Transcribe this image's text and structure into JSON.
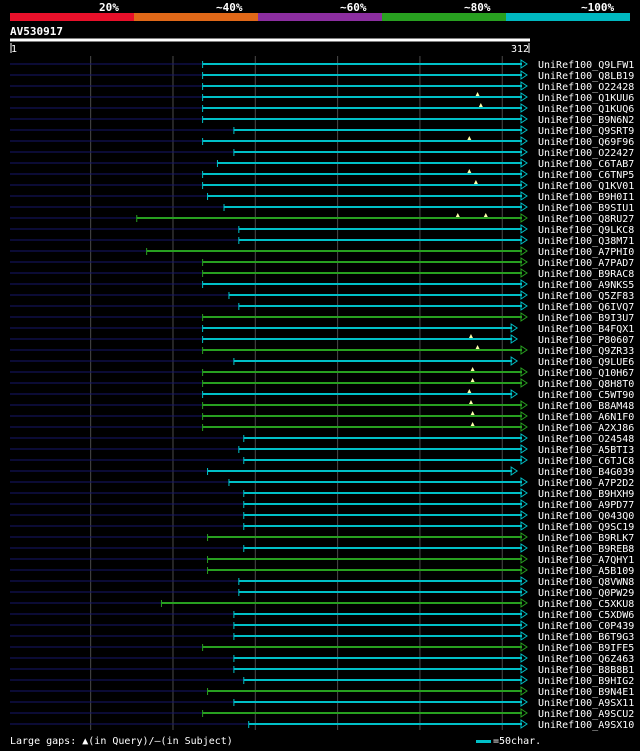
{
  "query": {
    "id": "AV530917",
    "start": "1",
    "end": "312"
  },
  "legend": {
    "bins": [
      {
        "label": "20%",
        "color": "#e8102a"
      },
      {
        "label": "~40%",
        "color": "#e06818"
      },
      {
        "label": "~60%",
        "color": "#8c2ea0"
      },
      {
        "label": "~80%",
        "color": "#28a020"
      },
      {
        "label": "~100%",
        "color": "#00b8c0"
      }
    ]
  },
  "footer": {
    "gaps_label": "Large gaps: ",
    "gap_query_icon": "triangle-up-icon",
    "gaps_query": "(in Query)/",
    "gap_subject_icon": "dash-icon",
    "gaps_subject": "(in Subject)",
    "scale_label": "=50char."
  },
  "chart_data": {
    "type": "alignment-overview",
    "query_length": 312,
    "x_range": [
      1,
      312
    ],
    "grid": true,
    "hits": [
      {
        "name": "UniRef100_Q9LFW1",
        "start": 118,
        "end": 312,
        "color": "cyan",
        "arrow": "open",
        "gaps": []
      },
      {
        "name": "UniRef100_Q8LB19",
        "start": 118,
        "end": 312,
        "color": "cyan",
        "arrow": "open",
        "gaps": []
      },
      {
        "name": "UniRef100_O22428",
        "start": 118,
        "end": 312,
        "color": "cyan",
        "arrow": "open",
        "gaps": []
      },
      {
        "name": "UniRef100_Q1KUU6",
        "start": 118,
        "end": 312,
        "color": "cyan",
        "arrow": "open",
        "gaps": [
          285
        ]
      },
      {
        "name": "UniRef100_Q1KUQ6",
        "start": 118,
        "end": 312,
        "color": "cyan",
        "arrow": "open",
        "gaps": [
          287
        ]
      },
      {
        "name": "UniRef100_B9N6N2",
        "start": 118,
        "end": 312,
        "color": "cyan",
        "arrow": "open",
        "gaps": []
      },
      {
        "name": "UniRef100_Q9SRT9",
        "start": 137,
        "end": 312,
        "color": "cyan",
        "arrow": "open",
        "gaps": []
      },
      {
        "name": "UniRef100_Q69F96",
        "start": 118,
        "end": 312,
        "color": "cyan",
        "arrow": "open",
        "gaps": [
          280
        ]
      },
      {
        "name": "UniRef100_O22427",
        "start": 137,
        "end": 312,
        "color": "cyan",
        "arrow": "open",
        "gaps": []
      },
      {
        "name": "UniRef100_C6TAB7",
        "start": 127,
        "end": 312,
        "color": "cyan",
        "arrow": "open",
        "gaps": []
      },
      {
        "name": "UniRef100_C6TNP5",
        "start": 118,
        "end": 312,
        "color": "cyan",
        "arrow": "open",
        "gaps": [
          280
        ]
      },
      {
        "name": "UniRef100_Q1KV01",
        "start": 118,
        "end": 312,
        "color": "cyan",
        "arrow": "open",
        "gaps": [
          284
        ]
      },
      {
        "name": "UniRef100_B9H0I1",
        "start": 121,
        "end": 312,
        "color": "cyan",
        "arrow": "open",
        "gaps": []
      },
      {
        "name": "UniRef100_B9SIU1",
        "start": 131,
        "end": 312,
        "color": "cyan",
        "arrow": "open",
        "gaps": []
      },
      {
        "name": "UniRef100_Q8RU27",
        "start": 78,
        "end": 312,
        "color": "green",
        "arrow": "open",
        "gaps": [
          273,
          290
        ]
      },
      {
        "name": "UniRef100_Q9LKC8",
        "start": 140,
        "end": 312,
        "color": "cyan",
        "arrow": "open",
        "gaps": []
      },
      {
        "name": "UniRef100_Q38M71",
        "start": 140,
        "end": 312,
        "color": "cyan",
        "arrow": "open",
        "gaps": []
      },
      {
        "name": "UniRef100_A7PHI0",
        "start": 84,
        "end": 312,
        "color": "green",
        "arrow": "open",
        "gaps": []
      },
      {
        "name": "UniRef100_A7PAD7",
        "start": 118,
        "end": 312,
        "color": "green",
        "arrow": "open",
        "gaps": []
      },
      {
        "name": "UniRef100_B9RAC8",
        "start": 118,
        "end": 312,
        "color": "green",
        "arrow": "open",
        "gaps": []
      },
      {
        "name": "UniRef100_A9NKS5",
        "start": 118,
        "end": 312,
        "color": "cyan",
        "arrow": "open",
        "gaps": []
      },
      {
        "name": "UniRef100_Q5ZF83",
        "start": 134,
        "end": 312,
        "color": "cyan",
        "arrow": "open",
        "gaps": []
      },
      {
        "name": "UniRef100_Q6IVQ7",
        "start": 140,
        "end": 312,
        "color": "cyan",
        "arrow": "open",
        "gaps": []
      },
      {
        "name": "UniRef100_B9I3U7",
        "start": 118,
        "end": 312,
        "color": "green",
        "arrow": "open",
        "gaps": []
      },
      {
        "name": "UniRef100_B4FQX1",
        "start": 118,
        "end": 306,
        "color": "cyan",
        "arrow": "open",
        "gaps": []
      },
      {
        "name": "UniRef100_P80607",
        "start": 118,
        "end": 306,
        "color": "cyan",
        "arrow": "open",
        "gaps": [
          281
        ]
      },
      {
        "name": "UniRef100_Q9ZR33",
        "start": 118,
        "end": 312,
        "color": "green",
        "arrow": "open",
        "gaps": [
          285
        ]
      },
      {
        "name": "UniRef100_Q9LUE6",
        "start": 137,
        "end": 306,
        "color": "cyan",
        "arrow": "open",
        "gaps": []
      },
      {
        "name": "UniRef100_Q10H67",
        "start": 118,
        "end": 312,
        "color": "green",
        "arrow": "open",
        "gaps": [
          282
        ]
      },
      {
        "name": "UniRef100_Q8H8T0",
        "start": 118,
        "end": 312,
        "color": "green",
        "arrow": "open",
        "gaps": [
          282
        ]
      },
      {
        "name": "UniRef100_C5WT90",
        "start": 118,
        "end": 306,
        "color": "cyan",
        "arrow": "open",
        "gaps": [
          280
        ]
      },
      {
        "name": "UniRef100_B8AM48",
        "start": 118,
        "end": 312,
        "color": "green",
        "arrow": "open",
        "gaps": [
          281
        ]
      },
      {
        "name": "UniRef100_A6N1F0",
        "start": 118,
        "end": 312,
        "color": "green",
        "arrow": "open",
        "gaps": [
          282
        ]
      },
      {
        "name": "UniRef100_A2XJ86",
        "start": 118,
        "end": 312,
        "color": "green",
        "arrow": "open",
        "gaps": [
          282
        ]
      },
      {
        "name": "UniRef100_O24548",
        "start": 143,
        "end": 312,
        "color": "cyan",
        "arrow": "open",
        "gaps": []
      },
      {
        "name": "UniRef100_A5BTI3",
        "start": 140,
        "end": 312,
        "color": "cyan",
        "arrow": "open",
        "gaps": []
      },
      {
        "name": "UniRef100_C6TJC8",
        "start": 143,
        "end": 312,
        "color": "cyan",
        "arrow": "open",
        "gaps": []
      },
      {
        "name": "UniRef100_B4G039",
        "start": 121,
        "end": 306,
        "color": "cyan",
        "arrow": "open",
        "gaps": []
      },
      {
        "name": "UniRef100_A7P2D2",
        "start": 134,
        "end": 312,
        "color": "cyan",
        "arrow": "open",
        "gaps": []
      },
      {
        "name": "UniRef100_B9HXH9",
        "start": 143,
        "end": 312,
        "color": "cyan",
        "arrow": "open",
        "gaps": []
      },
      {
        "name": "UniRef100_A9PD77",
        "start": 143,
        "end": 312,
        "color": "cyan",
        "arrow": "open",
        "gaps": []
      },
      {
        "name": "UniRef100_Q043Q0",
        "start": 143,
        "end": 312,
        "color": "cyan",
        "arrow": "open",
        "gaps": []
      },
      {
        "name": "UniRef100_Q9SC19",
        "start": 143,
        "end": 312,
        "color": "cyan",
        "arrow": "open",
        "gaps": []
      },
      {
        "name": "UniRef100_B9RLK7",
        "start": 121,
        "end": 312,
        "color": "green",
        "arrow": "open",
        "gaps": []
      },
      {
        "name": "UniRef100_B9REB8",
        "start": 143,
        "end": 312,
        "color": "cyan",
        "arrow": "open",
        "gaps": []
      },
      {
        "name": "UniRef100_A7QHY1",
        "start": 121,
        "end": 312,
        "color": "green",
        "arrow": "open",
        "gaps": []
      },
      {
        "name": "UniRef100_A5B109",
        "start": 121,
        "end": 312,
        "color": "green",
        "arrow": "open",
        "gaps": []
      },
      {
        "name": "UniRef100_Q8VWN8",
        "start": 140,
        "end": 312,
        "color": "cyan",
        "arrow": "open",
        "gaps": []
      },
      {
        "name": "UniRef100_Q0PW29",
        "start": 140,
        "end": 312,
        "color": "cyan",
        "arrow": "open",
        "gaps": []
      },
      {
        "name": "UniRef100_C5XKU8",
        "start": 93,
        "end": 312,
        "color": "green",
        "arrow": "open",
        "gaps": []
      },
      {
        "name": "UniRef100_C5XDW6",
        "start": 137,
        "end": 312,
        "color": "cyan",
        "arrow": "open",
        "gaps": []
      },
      {
        "name": "UniRef100_C0P439",
        "start": 137,
        "end": 312,
        "color": "cyan",
        "arrow": "open",
        "gaps": []
      },
      {
        "name": "UniRef100_B6T9G3",
        "start": 137,
        "end": 312,
        "color": "cyan",
        "arrow": "open",
        "gaps": []
      },
      {
        "name": "UniRef100_B9IFE5",
        "start": 118,
        "end": 312,
        "color": "green",
        "arrow": "open",
        "gaps": []
      },
      {
        "name": "UniRef100_Q6Z463",
        "start": 137,
        "end": 312,
        "color": "cyan",
        "arrow": "open",
        "gaps": []
      },
      {
        "name": "UniRef100_B8B8B1",
        "start": 137,
        "end": 312,
        "color": "cyan",
        "arrow": "open",
        "gaps": []
      },
      {
        "name": "UniRef100_B9HIG2",
        "start": 143,
        "end": 312,
        "color": "cyan",
        "arrow": "open",
        "gaps": []
      },
      {
        "name": "UniRef100_B9N4E1",
        "start": 121,
        "end": 312,
        "color": "green",
        "arrow": "open",
        "gaps": []
      },
      {
        "name": "UniRef100_A9SX11",
        "start": 137,
        "end": 312,
        "color": "cyan",
        "arrow": "open",
        "gaps": []
      },
      {
        "name": "UniRef100_A9SCU2",
        "start": 118,
        "end": 312,
        "color": "green",
        "arrow": "open",
        "gaps": []
      },
      {
        "name": "UniRef100_A9SX10",
        "start": 146,
        "end": 312,
        "color": "cyan",
        "arrow": "open",
        "gaps": []
      }
    ]
  }
}
